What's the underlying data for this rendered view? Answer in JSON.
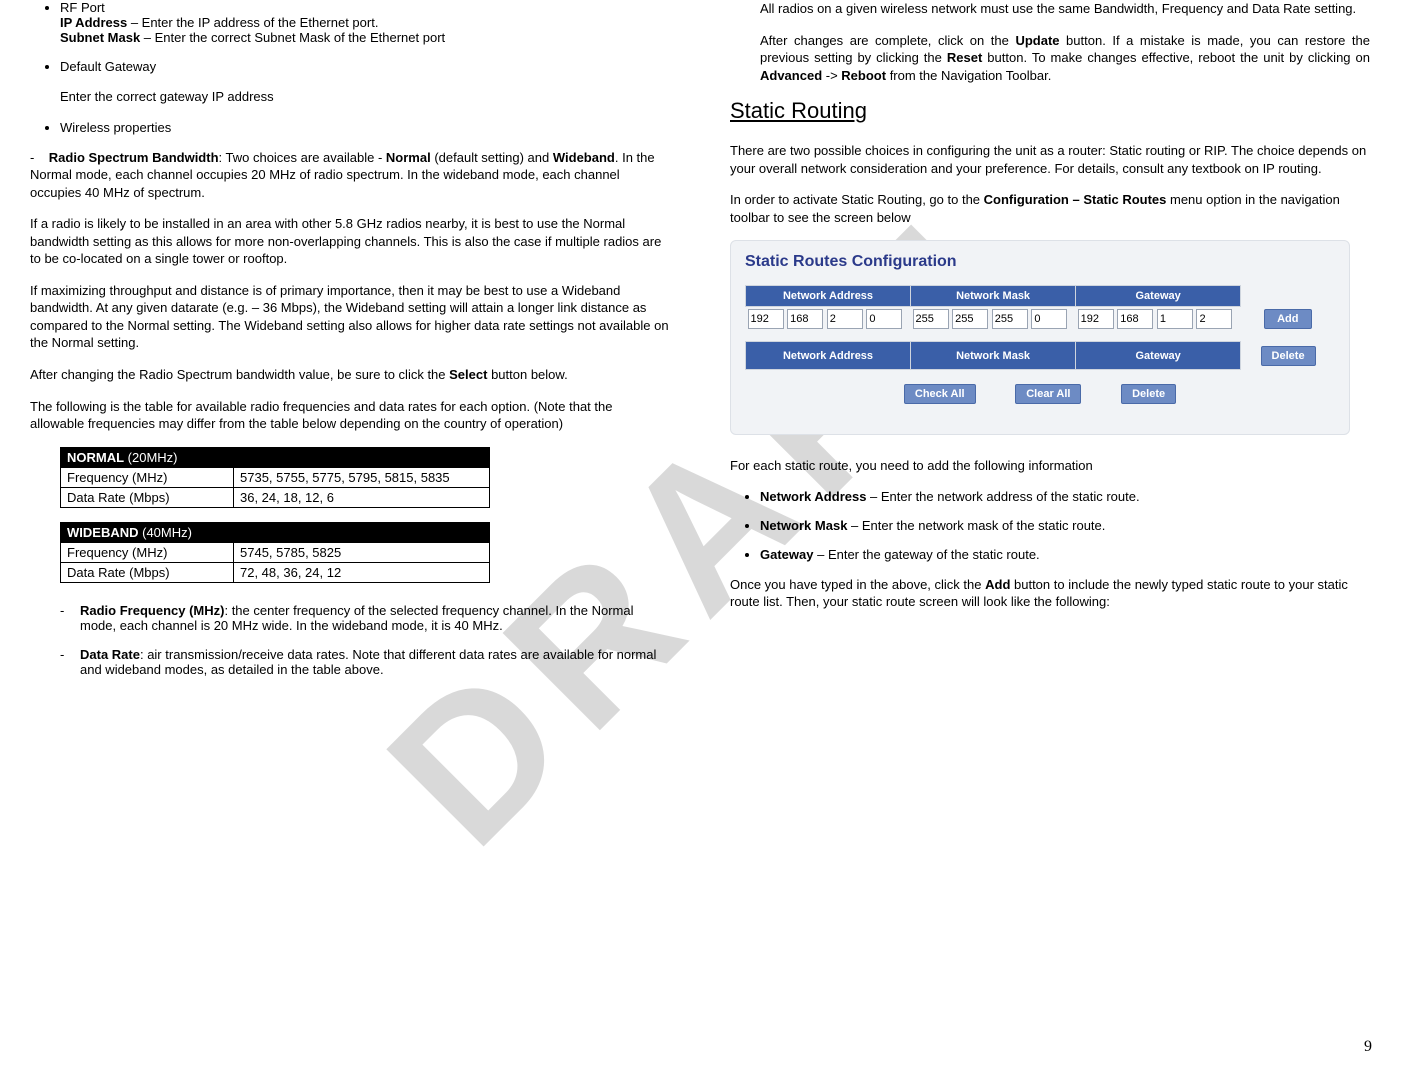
{
  "left": {
    "rfport_label": "RF Port",
    "ip_label": "IP Address",
    "ip_text": " – Enter the IP address of the Ethernet port.",
    "subnet_label": "Subnet Mask",
    "subnet_text": " – Enter the correct Subnet Mask of the Ethernet port",
    "gateway_label": "Default Gateway",
    "gateway_text": "Enter the correct gateway IP address",
    "wireless_label": "Wireless properties",
    "rsb_label": "Radio Spectrum Bandwidth",
    "rsb_text1": ":  Two choices are available - ",
    "rsb_normal": "Normal",
    "rsb_text2": " (default setting) and ",
    "rsb_wideband": "Wideband",
    "rsb_text3": ".   In the Normal mode, each channel occupies 20 MHz of radio spectrum.  In the wideband mode, each channel occupies 40 MHz of spectrum.",
    "para2": "If a radio is likely to be installed in an area with other 5.8 GHz radios nearby, it is best to use the Normal bandwidth setting as this allows for more non-overlapping channels.  This is also the case if multiple radios are to be co-located on a single tower or rooftop.",
    "para3": "If maximizing throughput and distance is of primary importance, then it may be best to use a Wideband bandwidth.  At any given datarate (e.g. – 36 Mbps), the Wideband setting will attain a longer link distance as compared to the Normal setting.  The Wideband setting also allows for higher data rate settings not available on the Normal setting.",
    "para4a": "After changing the Radio Spectrum bandwidth value, be sure to click the ",
    "para4b": "Select",
    "para4c": " button below.",
    "para5": "The following is the table for available radio frequencies and data rates for each option.  (Note that the allowable frequencies may differ from the table below depending on the country of operation)",
    "tbl_normal_hdr_b": "NORMAL",
    "tbl_normal_hdr_t": " (20MHz)",
    "tbl_freq_label": "Frequency (MHz)",
    "tbl_rate_label": "Data Rate (Mbps)",
    "tbl_normal_freq": "5735, 5755, 5775, 5795, 5815, 5835",
    "tbl_normal_rate": "36, 24, 18, 12, 6",
    "tbl_wide_hdr_b": "WIDEBAND",
    "tbl_wide_hdr_t": " (40MHz)",
    "tbl_wide_freq": "5745, 5785, 5825",
    "tbl_wide_rate": "72, 48, 36, 24, 12",
    "rf_label": "Radio Frequency (MHz)",
    "rf_text": ": the center frequency of the selected frequency channel. In the Normal mode, each channel is 20 MHz wide. In the wideband mode, it is 40 MHz.",
    "dr_label": "Data Rate",
    "dr_text": ": air transmission/receive data rates. Note that different data rates are available for normal and wideband modes, as detailed in the table above."
  },
  "right": {
    "para1": "All radios on a given wireless network must use the same Bandwidth, Frequency and Data Rate setting.",
    "para2a": "After changes are complete, click on the ",
    "para2_update": "Update",
    "para2b": " button.  If a mistake is made, you can restore the previous setting by clicking the ",
    "para2_reset": "Reset",
    "para2c": " button.   To make changes effective, reboot the unit by clicking on ",
    "para2_adv": "Advanced",
    "para2d": " -> ",
    "para2_reboot": "Reboot",
    "para2e": " from the Navigation Toolbar.",
    "h2": "Static Routing",
    "para3": "There are two possible choices in configuring the unit as a router: Static routing or RIP. The choice depends on your overall network consideration and your preference. For details, consult any textbook on IP routing.",
    "para4a": "In order to activate Static Routing, go to the ",
    "para4b": "Configuration – Static Routes",
    "para4c": " menu option in the navigation toolbar to see the screen below",
    "cfg": {
      "title": "Static Routes Configuration",
      "col1": "Network Address",
      "col2": "Network Mask",
      "col3": "Gateway",
      "add": "Add",
      "delete": "Delete",
      "checkall": "Check All",
      "clearall": "Clear All",
      "na": [
        "192",
        "168",
        "2",
        "0"
      ],
      "nm": [
        "255",
        "255",
        "255",
        "0"
      ],
      "gw": [
        "192",
        "168",
        "1",
        "2"
      ]
    },
    "para5": "For each static route, you need to add the following information",
    "li1a": "Network Address",
    "li1b": " – Enter the network address of the static route.",
    "li2a": "Network Mask",
    "li2b": " – Enter the network mask of the static route.",
    "li3a": "Gateway",
    "li3b": " – Enter the gateway of the static route.",
    "para6a": "Once you have typed in the above, click the ",
    "para6b": "Add",
    "para6c": " button to include the newly typed static route to your static route list. Then, your static route screen will look like the following:"
  },
  "pagenum": "9"
}
